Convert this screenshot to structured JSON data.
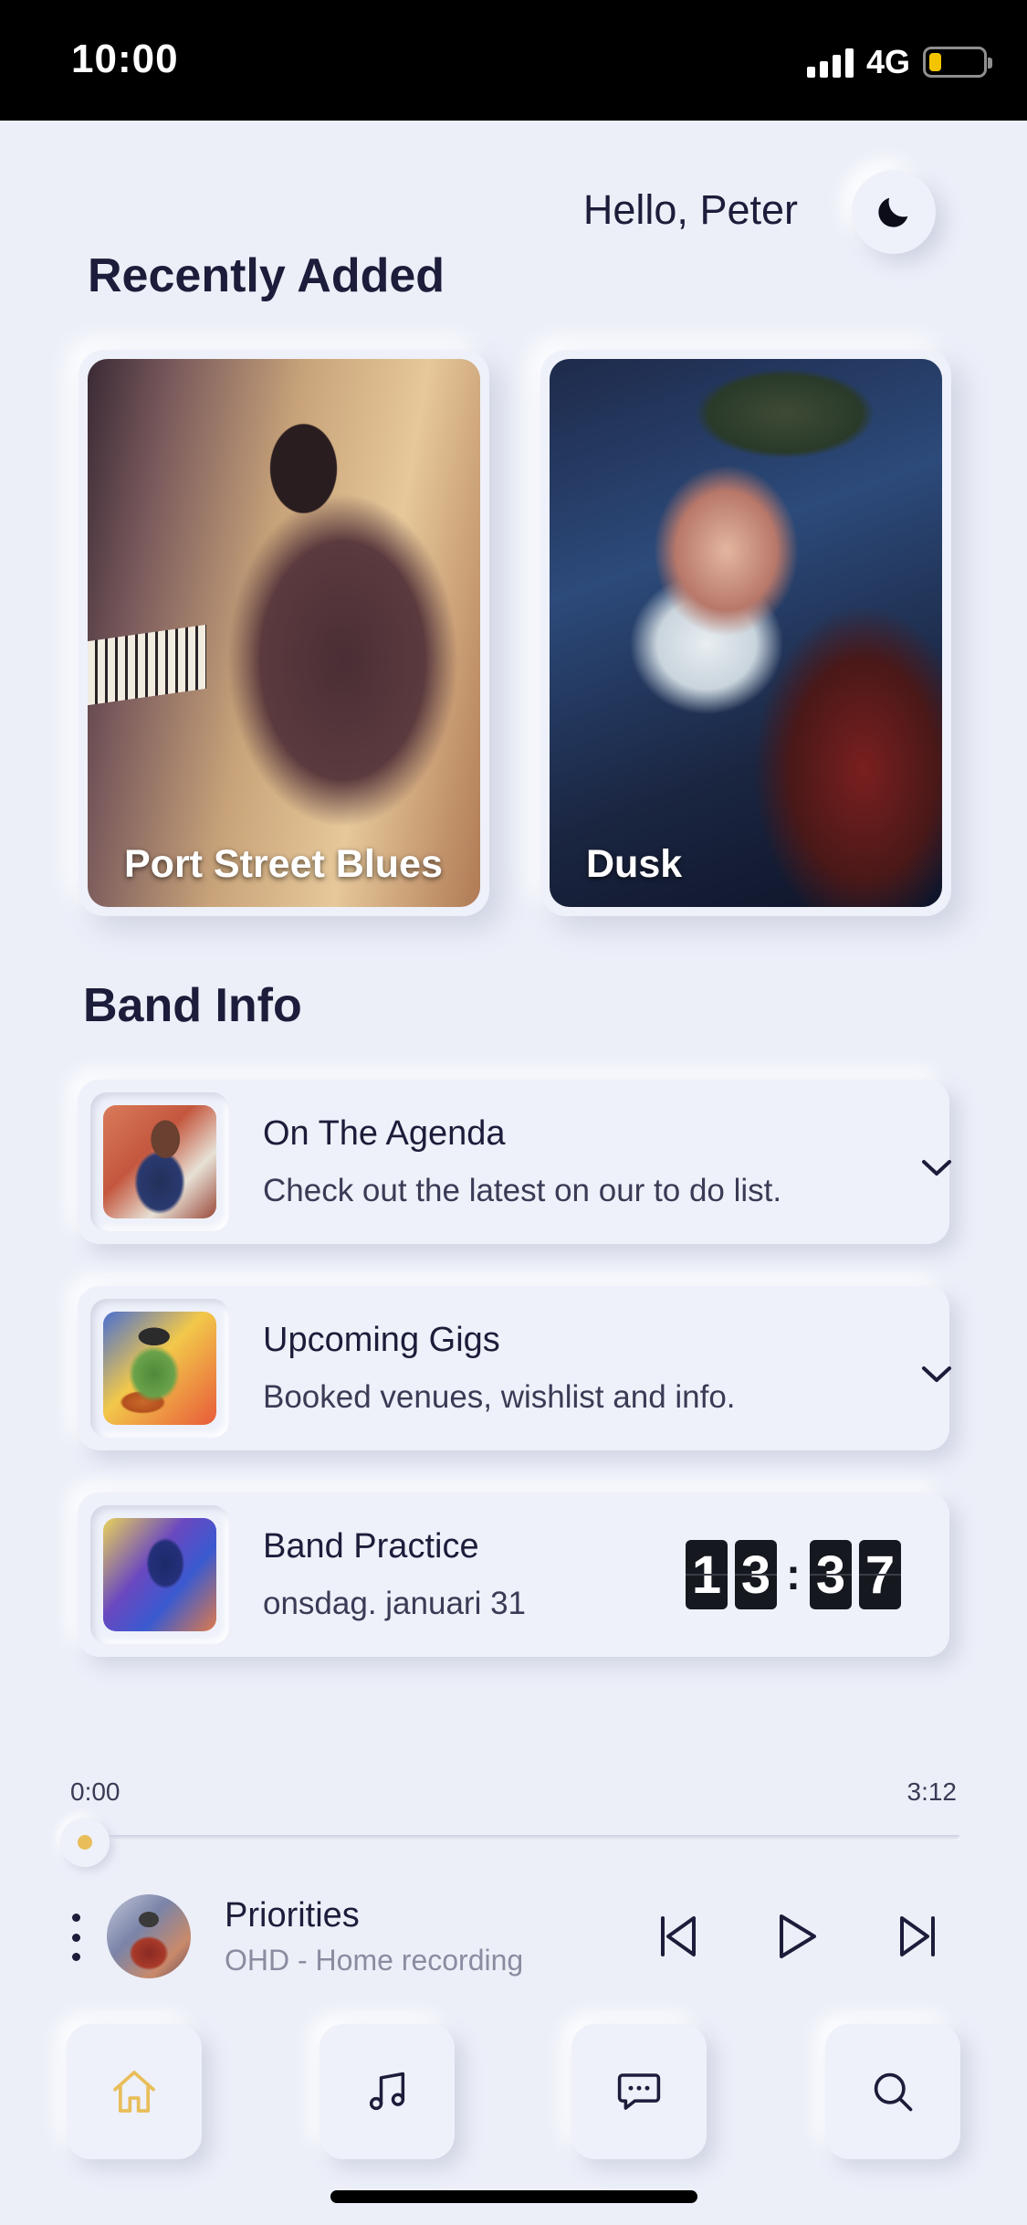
{
  "status_bar": {
    "time": "10:00",
    "network": "4G",
    "battery_level": 0.2,
    "battery_color": "#f5c400"
  },
  "header": {
    "greeting": "Hello, Peter",
    "theme_toggle_icon": "moon-icon"
  },
  "recently_added": {
    "title": "Recently Added",
    "albums": [
      {
        "title": "Port Street Blues"
      },
      {
        "title": "Dusk"
      }
    ]
  },
  "band_info": {
    "title": "Band Info",
    "cards": [
      {
        "title": "On The Agenda",
        "subtitle": "Check out the latest on our to do list.",
        "action_icon": "chevron-down-icon"
      },
      {
        "title": "Upcoming Gigs",
        "subtitle": "Booked venues, wishlist and info.",
        "action_icon": "chevron-down-icon"
      },
      {
        "title": "Band Practice",
        "subtitle": "onsdag. januari 31",
        "clock": {
          "h1": "1",
          "h2": "3",
          "sep": ":",
          "m1": "3",
          "m2": "7"
        }
      }
    ]
  },
  "player": {
    "elapsed": "0:00",
    "duration": "3:12",
    "progress": 0,
    "track_title": "Priorities",
    "track_subtitle": "OHD - Home recording",
    "accent_color": "#e9bd5a"
  },
  "nav": {
    "items": [
      "home-icon",
      "music-note-icon",
      "chat-icon",
      "search-icon"
    ],
    "active": "home-icon",
    "active_color": "#e9bd5a"
  }
}
